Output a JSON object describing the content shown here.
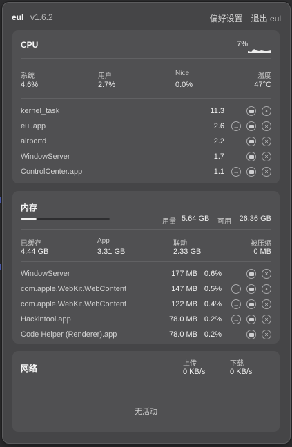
{
  "app": {
    "name": "eul",
    "version": "v1.6.2",
    "settings_label": "偏好设置",
    "quit_label": "退出 eul"
  },
  "cpu": {
    "title": "CPU",
    "usage_percent": "7%",
    "stats": [
      {
        "label": "系统",
        "value": "4.6%"
      },
      {
        "label": "用户",
        "value": "2.7%"
      },
      {
        "label": "Nice",
        "value": "0.0%"
      },
      {
        "label": "温度",
        "value": "47°C"
      }
    ],
    "processes": [
      {
        "name": "kernel_task",
        "value": "11.3",
        "icons": [
          "folder-icon",
          "close-icon"
        ]
      },
      {
        "name": "eul.app",
        "value": "2.6",
        "icons": [
          "arrow-right-icon",
          "folder-icon",
          "close-icon"
        ]
      },
      {
        "name": "airportd",
        "value": "2.2",
        "icons": [
          "folder-icon",
          "close-icon"
        ]
      },
      {
        "name": "WindowServer",
        "value": "1.7",
        "icons": [
          "folder-icon",
          "close-icon"
        ]
      },
      {
        "name": "ControlCenter.app",
        "value": "1.1",
        "icons": [
          "arrow-right-icon",
          "folder-icon",
          "close-icon"
        ]
      }
    ]
  },
  "memory": {
    "title": "内存",
    "used_label": "用量",
    "used_value": "5.64 GB",
    "available_label": "可用",
    "available_value": "26.36 GB",
    "usage_fraction": 0.18,
    "stats": [
      {
        "label": "已缓存",
        "value": "4.44 GB"
      },
      {
        "label": "App",
        "value": "3.31 GB"
      },
      {
        "label": "联动",
        "value": "2.33 GB"
      },
      {
        "label": "被压缩",
        "value": "0 MB"
      }
    ],
    "processes": [
      {
        "name": "WindowServer",
        "size": "177 MB",
        "percent": "0.6%",
        "icons": [
          "folder-icon",
          "close-icon"
        ]
      },
      {
        "name": "com.apple.WebKit.WebContent",
        "size": "147 MB",
        "percent": "0.5%",
        "icons": [
          "arrow-right-icon",
          "folder-icon",
          "close-icon"
        ]
      },
      {
        "name": "com.apple.WebKit.WebContent",
        "size": "122 MB",
        "percent": "0.4%",
        "icons": [
          "arrow-right-icon",
          "folder-icon",
          "close-icon"
        ]
      },
      {
        "name": "Hackintool.app",
        "size": "78.0 MB",
        "percent": "0.2%",
        "icons": [
          "arrow-right-icon",
          "folder-icon",
          "close-icon"
        ]
      },
      {
        "name": "Code Helper (Renderer).app",
        "size": "78.0 MB",
        "percent": "0.2%",
        "icons": [
          "folder-icon",
          "close-icon"
        ]
      }
    ]
  },
  "network": {
    "title": "网络",
    "upload_label": "上传",
    "upload_value": "0 KB/s",
    "download_label": "下载",
    "download_value": "0 KB/s",
    "empty_text": "无活动"
  }
}
